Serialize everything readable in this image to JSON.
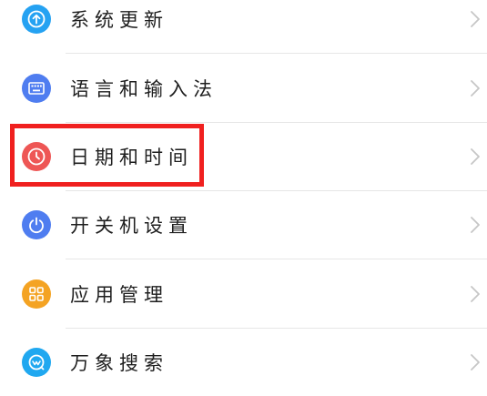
{
  "settings": {
    "items": [
      {
        "label": "系统更新",
        "icon": "upload-arrow-icon",
        "color": "#25a2f2"
      },
      {
        "label": "语言和输入法",
        "icon": "keyboard-icon",
        "color": "#4f7df0"
      },
      {
        "label": "日期和时间",
        "icon": "clock-icon",
        "color": "#ee5655"
      },
      {
        "label": "开关机设置",
        "icon": "power-icon",
        "color": "#4f7df0"
      },
      {
        "label": "应用管理",
        "icon": "apps-grid-icon",
        "color": "#f4a323"
      },
      {
        "label": "万象搜索",
        "icon": "search-icon",
        "color": "#20a8f0"
      }
    ]
  },
  "highlight": {
    "color": "#f0201f"
  },
  "chevron_color": "#c6c6c6"
}
